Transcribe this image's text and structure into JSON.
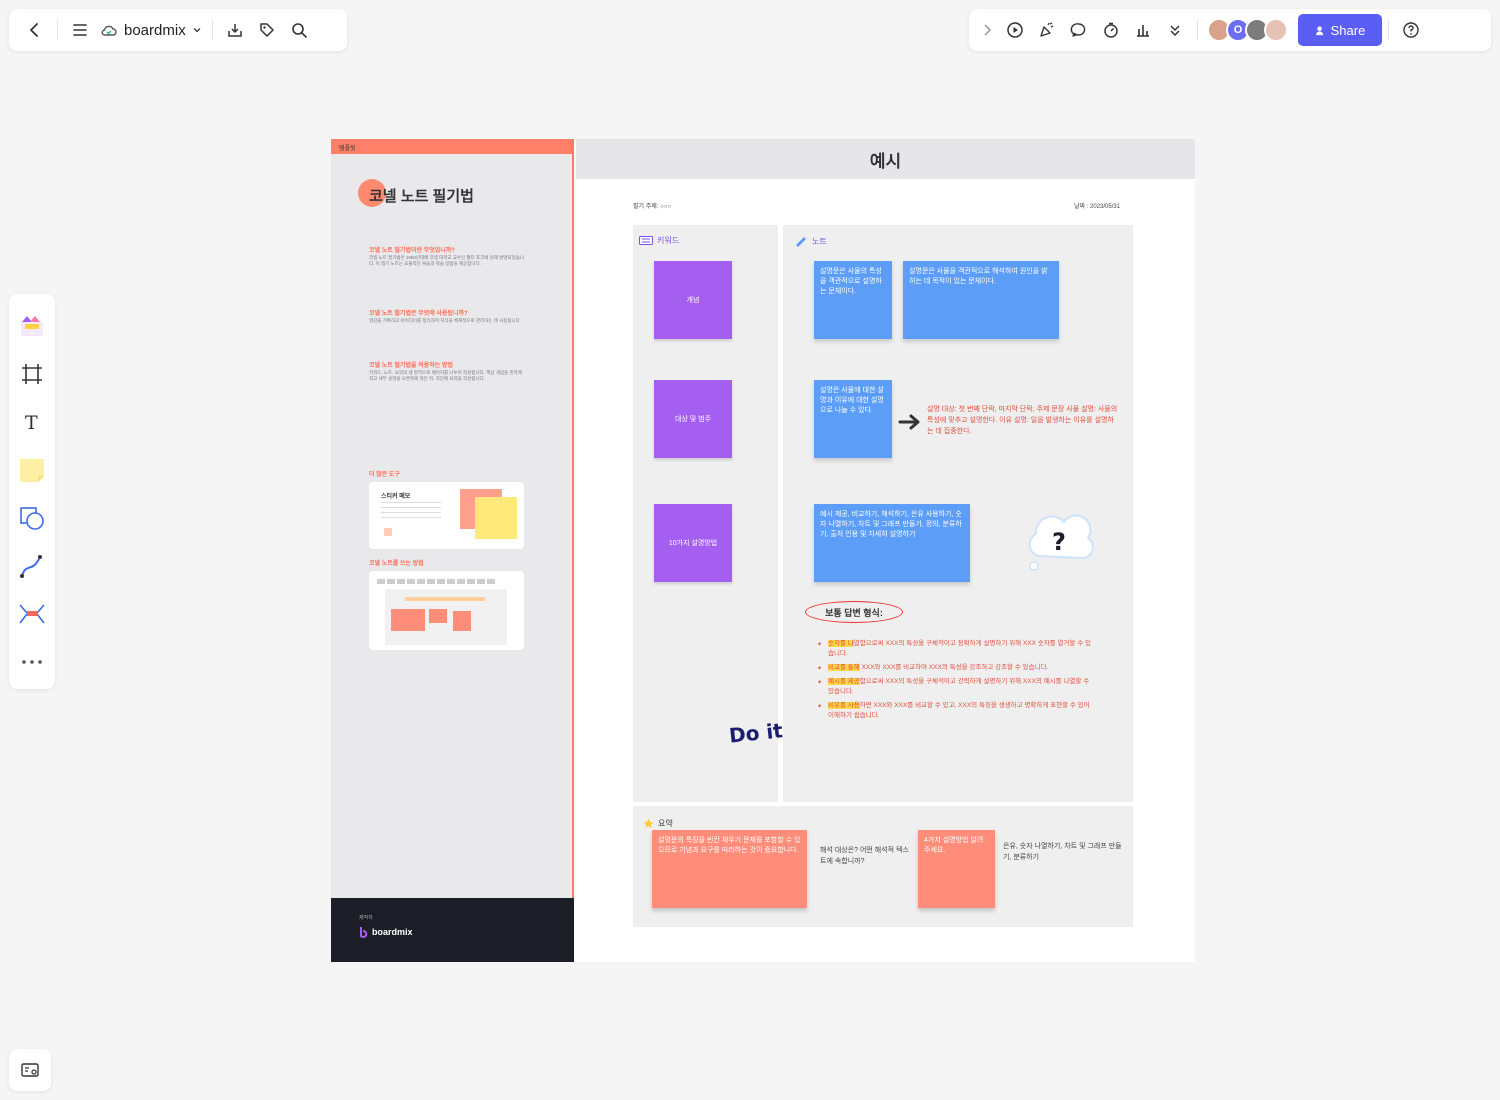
{
  "topbar": {
    "brand": "boardmix",
    "share_label": "Share",
    "avatar_letter": "O"
  },
  "board": {
    "side": {
      "strip": "템플릿",
      "title": "코넬 노트 필기법",
      "h1": "코넬 노트 필기법이란 무엇입니까?",
      "p1": "코넬 노트 필기법은 1950년대에 코넬 대학교 교수인 월터 포크에 의해 발명되었습니다. 이 필기 노트는 효율적인 복습과 학습 방법을 제공합니다.",
      "h2": "코넬 노트 필기법은 무엇에 사용됩니까?",
      "p2": "영감을 기록하고 아이디어를 정리하며 지식을 체계적으로 관리하는 데 사용됩니다.",
      "h3": "코넬 노트 필기법을 적용하는 방법",
      "p3": "키워드, 노트, 요약의 세 영역으로 페이지를 나누어 작성합니다. 핵심 개념을 왼쪽에 적고 세부 설명을 오른쪽에 적은 뒤, 하단에 요약을 작성합니다.",
      "h4": "더 많은 도구",
      "card1_title": "스티커 메모",
      "h5": "코넬 노트를 쓰는 방법",
      "foot_label": "제작자",
      "foot_logo": "boardmix"
    },
    "main": {
      "header": "예시",
      "meta_left": "필기 주제: ○○○",
      "meta_right": "날짜 : 2023/05/31",
      "keyword_label": "키워드",
      "note_label": "노트",
      "summary_label": "요약",
      "kw1": "개념",
      "kw2": "대상 및 범주",
      "kw3": "10가지 설명방법",
      "blue1": "설명문은 사물의 특성을 객관적으로 설명하는 문체이다.",
      "blue2": "설명문은 사물을 객관적으로 해석하여 원인을 밝히는 데 목적이 있는 문체이다.",
      "blue3": "설명은 사물에 대한 설명과 이유에 대한 설명으로 나눌 수 있다.",
      "red_expl": "설명 대상: 첫 번째 단락, 마지막 단락, 주제 문장 사물 설명: 사물의 특성에 맞추고 설명한다. 이유 설명: 일을 발생하는 이유를 설명하는 데 집중한다.",
      "blue4": "예시 제공, 비교하기, 해석하기, 은유 사용하기, 숫자 나열하기, 차트 및 그래프 만들기, 정의, 분류하기, 출처 인용 및 자세히 설명하기",
      "answer_title": "보통 답변 형식:",
      "bullets": [
        {
          "hl": "숫자를 나",
          "rest": "열함으로써 XXX의 특성을 구체적이고 정확하게 설명하기 위해 XXX 숫자를 열거할 수 있습니다."
        },
        {
          "hl": "비교를 통해",
          "rest": " XXX와 XXX를 비교하여 XXX의 특성을 강조하고 강조할 수 있습니다."
        },
        {
          "hl": "예시를 제공",
          "rest": "함으로써 XXX의 특성을 구체적이고 강력하게 설명하기 위해 XXX의 예시를 나열할 수 있습니다."
        },
        {
          "hl": "비유를 사용",
          "rest": "하면 XXX와 XXX를 비교할 수 있고, XXX의 특징을 생생하고 명확하게 표현할 수 있어 이해하기 쉽습니다."
        }
      ],
      "doit": "Do it",
      "sum1": "설명문의 특징을 빈칸 채우기 문제를 포함할 수 있으므로 기념과 요구를 따라하는 것이 중요합니다.",
      "sum_q": "해석 대상은? 어떤 해석적 텍스트에 속합니까?",
      "sum2": "4가지 설명방법 알려주세요.",
      "sum_a": "은유, 숫자 나열하기, 차트 및 그래프 만들기, 분류하기"
    }
  },
  "colors": {
    "accent": "#5b5ef4",
    "purple_note": "#a45ef0",
    "blue_note": "#5b9df7",
    "salmon_note": "#ff8d79",
    "red_text": "#e0503c"
  }
}
